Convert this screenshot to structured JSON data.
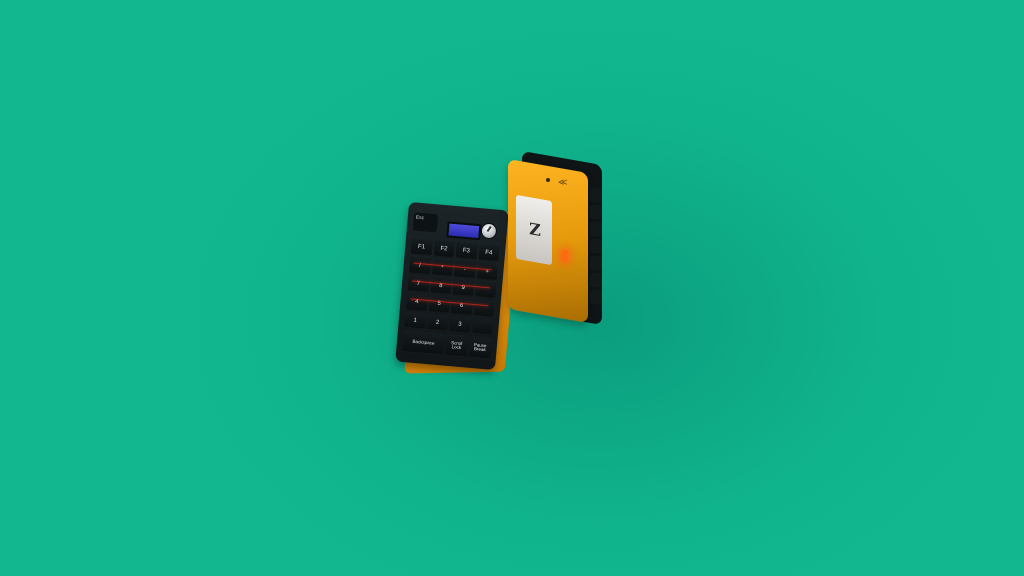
{
  "scene": {
    "background_color": "#10b48c",
    "accent_orange": "#f3a31a",
    "lcd_color": "#3b3bc8",
    "underglow_color": "#ff2a1a"
  },
  "keypad": {
    "esc_label": "Esc",
    "rows": [
      [
        "F1",
        "F2",
        "F3",
        "F4"
      ],
      [
        "/",
        "*",
        "-",
        "+"
      ],
      [
        "7",
        "8",
        "9",
        ""
      ],
      [
        "4",
        "5",
        "6",
        ""
      ],
      [
        "1",
        "2",
        "3",
        ""
      ]
    ],
    "bottom_keys": [
      "Backspace",
      "Scroll\nLock",
      "Pause\nBreak"
    ]
  },
  "flip_device": {
    "logo_letter": "Z",
    "mark_glyph": "≪"
  }
}
